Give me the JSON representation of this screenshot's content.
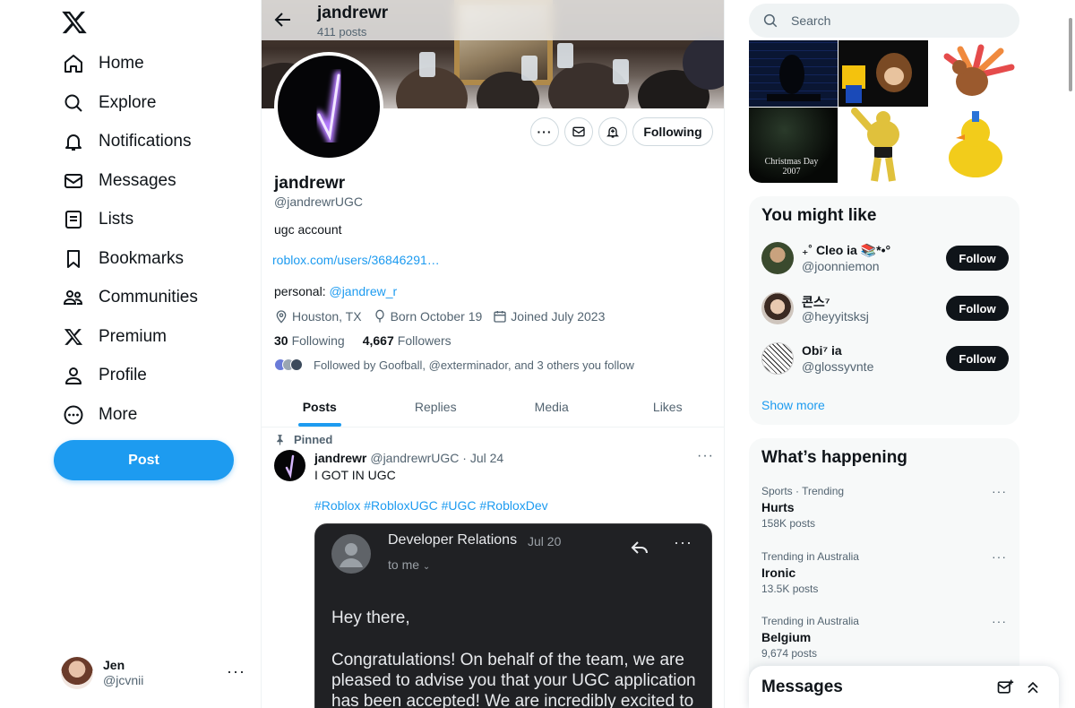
{
  "nav": {
    "items": [
      {
        "label": "Home",
        "icon": "home-icon"
      },
      {
        "label": "Explore",
        "icon": "search-icon"
      },
      {
        "label": "Notifications",
        "icon": "bell-icon"
      },
      {
        "label": "Messages",
        "icon": "envelope-icon"
      },
      {
        "label": "Lists",
        "icon": "list-icon"
      },
      {
        "label": "Bookmarks",
        "icon": "bookmark-icon"
      },
      {
        "label": "Communities",
        "icon": "communities-icon"
      },
      {
        "label": "Premium",
        "icon": "x-logo-icon"
      },
      {
        "label": "Profile",
        "icon": "person-icon"
      },
      {
        "label": "More",
        "icon": "more-circle-icon"
      }
    ],
    "post_label": "Post"
  },
  "account": {
    "name": "Jen",
    "handle": "@jcvnii"
  },
  "header": {
    "name": "jandrewr",
    "posts": "411 posts"
  },
  "profile": {
    "name": "jandrewr",
    "handle": "@jandrewrUGC",
    "bio": "ugc account",
    "link": "roblox.com/users/36846291…",
    "personal_prefix": "personal: ",
    "personal_handle": "@jandrew_r",
    "location": "Houston, TX",
    "born": "Born October 19",
    "joined": "Joined July 2023",
    "following_count": "30",
    "following_label": "Following",
    "followers_count": "4,667",
    "followers_label": "Followers",
    "followed_by": "Followed by Goofball, @exterminador, and 3 others you follow",
    "following_button": "Following"
  },
  "tabs": [
    "Posts",
    "Replies",
    "Media",
    "Likes"
  ],
  "tweet": {
    "pinned": "Pinned",
    "author": "jandrewr",
    "handle_date": "@jandrewrUGC · Jul 24",
    "text": "I GOT IN UGC",
    "hashtags": "#Roblox #RobloxUGC #UGC #RobloxDev",
    "email": {
      "sender": "Developer Relations",
      "date": "Jul 20",
      "to": "to me",
      "greeting": "Hey there,",
      "body": "Congratulations! On behalf of the team, we are pleased to advise you that your UGC application has been accepted! We are incredibly excited to"
    }
  },
  "search": {
    "placeholder": "Search"
  },
  "media_grid": {
    "caption": "Christmas Day 2007"
  },
  "might_like": {
    "title": "You might like",
    "users": [
      {
        "name": "₊˚ Cleo ia 📚*•°",
        "handle": "@joonniemon",
        "button": "Follow"
      },
      {
        "name": "콘스⁷",
        "handle": "@heyyitsksj",
        "button": "Follow"
      },
      {
        "name": "Obi⁷ ia",
        "handle": "@glossyvnte",
        "button": "Follow"
      }
    ],
    "show_more": "Show more"
  },
  "happening": {
    "title": "What’s happening",
    "trends": [
      {
        "context": "Sports · Trending",
        "name": "Hurts",
        "count": "158K posts"
      },
      {
        "context": "Trending in Australia",
        "name": "Ironic",
        "count": "13.5K posts"
      },
      {
        "context": "Trending in Australia",
        "name": "Belgium",
        "count": "9,674 posts"
      }
    ]
  },
  "messages_drawer": {
    "title": "Messages"
  },
  "colors": {
    "accent": "#1d9bf0",
    "text": "#0f1419",
    "muted": "#536471"
  }
}
